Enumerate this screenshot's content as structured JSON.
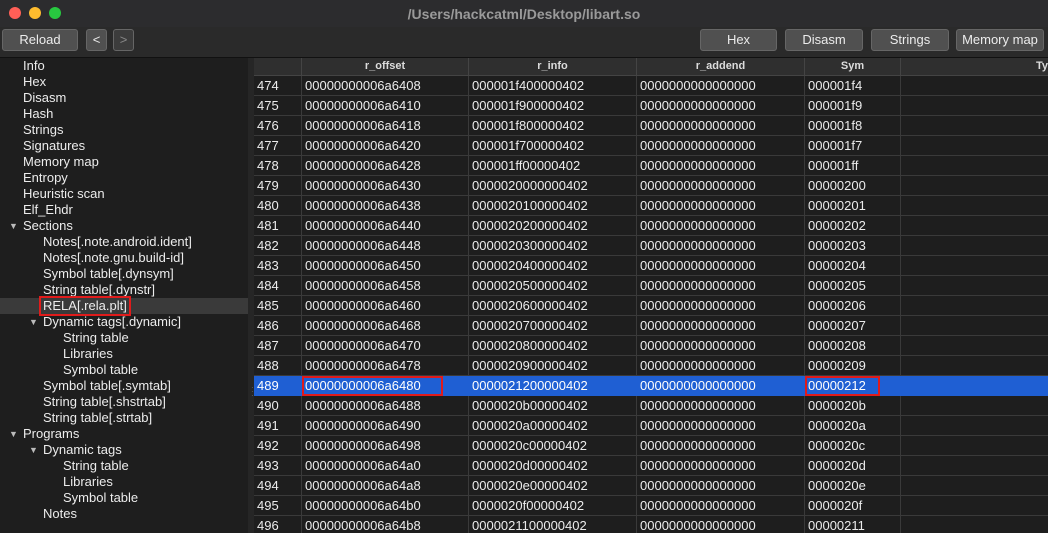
{
  "window": {
    "title": "/Users/hackcatml/Desktop/libart.so"
  },
  "toolbar": {
    "reload": "Reload",
    "back": "<",
    "forward": ">",
    "hex": "Hex",
    "disasm": "Disasm",
    "strings": "Strings",
    "memory_map": "Memory map"
  },
  "sidebar": {
    "items": [
      {
        "label": "Info",
        "level": 0
      },
      {
        "label": "Hex",
        "level": 0
      },
      {
        "label": "Disasm",
        "level": 0
      },
      {
        "label": "Hash",
        "level": 0
      },
      {
        "label": "Strings",
        "level": 0
      },
      {
        "label": "Signatures",
        "level": 0
      },
      {
        "label": "Memory map",
        "level": 0
      },
      {
        "label": "Entropy",
        "level": 0
      },
      {
        "label": "Heuristic scan",
        "level": 0
      },
      {
        "label": "Elf_Ehdr",
        "level": 0
      },
      {
        "label": "Sections",
        "level": 0,
        "expanded": true
      },
      {
        "label": "Notes[.note.android.ident]",
        "level": 1
      },
      {
        "label": "Notes[.note.gnu.build-id]",
        "level": 1
      },
      {
        "label": "Symbol table[.dynsym]",
        "level": 1
      },
      {
        "label": "String table[.dynstr]",
        "level": 1
      },
      {
        "label": "RELA[.rela.plt]",
        "level": 1,
        "selected": true
      },
      {
        "label": "Dynamic tags[.dynamic]",
        "level": 1,
        "expanded": true
      },
      {
        "label": "String table",
        "level": 2
      },
      {
        "label": "Libraries",
        "level": 2
      },
      {
        "label": "Symbol table",
        "level": 2
      },
      {
        "label": "Symbol table[.symtab]",
        "level": 1
      },
      {
        "label": "String table[.shstrtab]",
        "level": 1
      },
      {
        "label": "String table[.strtab]",
        "level": 1
      },
      {
        "label": "Programs",
        "level": 0,
        "expanded": true
      },
      {
        "label": "Dynamic tags",
        "level": 1,
        "expanded": true
      },
      {
        "label": "String table",
        "level": 2
      },
      {
        "label": "Libraries",
        "level": 2
      },
      {
        "label": "Symbol table",
        "level": 2
      },
      {
        "label": "Notes",
        "level": 1
      }
    ]
  },
  "table": {
    "columns": [
      "",
      "r_offset",
      "r_info",
      "r_addend",
      "Sym",
      "Ty"
    ],
    "rows": [
      [
        "474",
        "00000000006a6408",
        "000001f400000402",
        "0000000000000000",
        "000001f4"
      ],
      [
        "475",
        "00000000006a6410",
        "000001f900000402",
        "0000000000000000",
        "000001f9"
      ],
      [
        "476",
        "00000000006a6418",
        "000001f800000402",
        "0000000000000000",
        "000001f8"
      ],
      [
        "477",
        "00000000006a6420",
        "000001f700000402",
        "0000000000000000",
        "000001f7"
      ],
      [
        "478",
        "00000000006a6428",
        "000001ff00000402",
        "0000000000000000",
        "000001ff"
      ],
      [
        "479",
        "00000000006a6430",
        "0000020000000402",
        "0000000000000000",
        "00000200"
      ],
      [
        "480",
        "00000000006a6438",
        "0000020100000402",
        "0000000000000000",
        "00000201"
      ],
      [
        "481",
        "00000000006a6440",
        "0000020200000402",
        "0000000000000000",
        "00000202"
      ],
      [
        "482",
        "00000000006a6448",
        "0000020300000402",
        "0000000000000000",
        "00000203"
      ],
      [
        "483",
        "00000000006a6450",
        "0000020400000402",
        "0000000000000000",
        "00000204"
      ],
      [
        "484",
        "00000000006a6458",
        "0000020500000402",
        "0000000000000000",
        "00000205"
      ],
      [
        "485",
        "00000000006a6460",
        "0000020600000402",
        "0000000000000000",
        "00000206"
      ],
      [
        "486",
        "00000000006a6468",
        "0000020700000402",
        "0000000000000000",
        "00000207"
      ],
      [
        "487",
        "00000000006a6470",
        "0000020800000402",
        "0000000000000000",
        "00000208"
      ],
      [
        "488",
        "00000000006a6478",
        "0000020900000402",
        "0000000000000000",
        "00000209"
      ],
      [
        "489",
        "00000000006a6480",
        "0000021200000402",
        "0000000000000000",
        "00000212"
      ],
      [
        "490",
        "00000000006a6488",
        "0000020b00000402",
        "0000000000000000",
        "0000020b"
      ],
      [
        "491",
        "00000000006a6490",
        "0000020a00000402",
        "0000000000000000",
        "0000020a"
      ],
      [
        "492",
        "00000000006a6498",
        "0000020c00000402",
        "0000000000000000",
        "0000020c"
      ],
      [
        "493",
        "00000000006a64a0",
        "0000020d00000402",
        "0000000000000000",
        "0000020d"
      ],
      [
        "494",
        "00000000006a64a8",
        "0000020e00000402",
        "0000000000000000",
        "0000020e"
      ],
      [
        "495",
        "00000000006a64b0",
        "0000020f00000402",
        "0000000000000000",
        "0000020f"
      ],
      [
        "496",
        "00000000006a64b8",
        "0000021100000402",
        "0000000000000000",
        "00000211"
      ]
    ],
    "selected_row": "489"
  },
  "colors": {
    "selection": "#1f5fd3",
    "highlight_box": "#e01b1b"
  }
}
